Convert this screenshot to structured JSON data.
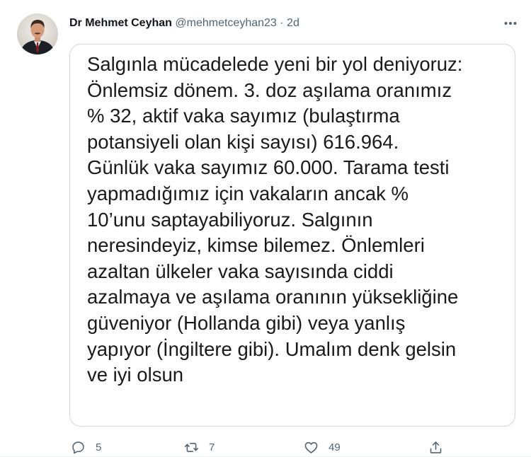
{
  "tweet": {
    "author_name": "Dr Mehmet Ceyhan",
    "handle": "@mehmetceyhan23",
    "separator": "·",
    "time": "2d",
    "image_text": "Salgınla mücadelede yeni bir yol deniyoruz:\nÖnlemsiz dönem.  3. doz aşılama oranımız\n% 32, aktif vaka sayımız (bulaştırma\npotansiyeli olan kişi sayısı) 616.964.\nGünlük vaka sayımız 60.000. Tarama testi\nyapmadığımız için vakaların ancak %\n10’unu saptayabiliyoruz. Salgının\nneresindeyiz, kimse bilemez. Önlemleri\nazaltan ülkeler vaka sayısında ciddi\nazalmaya ve aşılama oranının yüksekliğine\ngüveniyor (Hollanda gibi) veya yanlış\nyapıyor (İngiltere gibi). Umalım denk gelsin\nve iyi olsun"
  },
  "actions": {
    "reply": {
      "icon": "reply-icon",
      "count": "5"
    },
    "retweet": {
      "icon": "retweet-icon",
      "count": "7"
    },
    "like": {
      "icon": "heart-icon",
      "count": "49"
    },
    "share": {
      "icon": "share-icon",
      "count": ""
    }
  },
  "colors": {
    "text": "#0f1419",
    "secondary": "#536471",
    "border": "#cfd9de"
  }
}
